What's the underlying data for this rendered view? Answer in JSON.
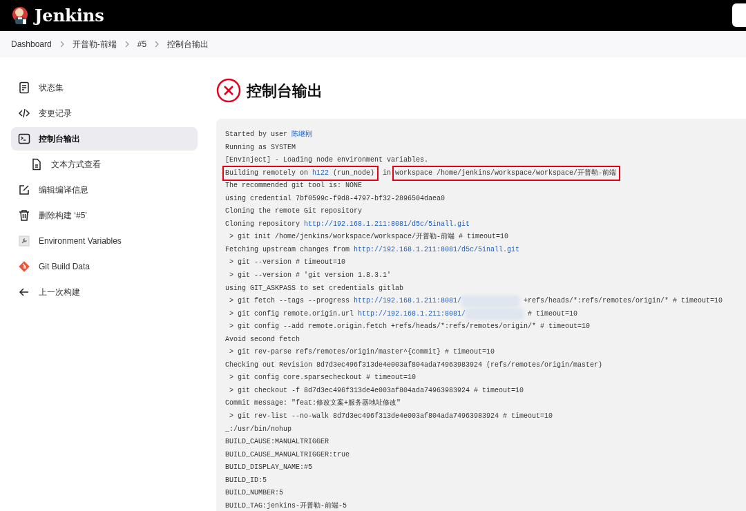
{
  "header": {
    "brand": "Jenkins"
  },
  "breadcrumbs": [
    "Dashboard",
    "开普勒-前端",
    "#5",
    "控制台输出"
  ],
  "sidebar": {
    "items": [
      {
        "kind": "doc",
        "label": "状态集",
        "selected": false
      },
      {
        "kind": "code",
        "label": "变更记录",
        "selected": false
      },
      {
        "kind": "terminal",
        "label": "控制台输出",
        "selected": true
      },
      {
        "kind": "file",
        "label": "文本方式查看",
        "selected": false,
        "sub": true
      },
      {
        "kind": "edit",
        "label": "编辑编译信息",
        "selected": false
      },
      {
        "kind": "trash",
        "label": "删除构建 ‘#5’",
        "selected": false
      },
      {
        "kind": "env",
        "label": "Environment Variables",
        "selected": false
      },
      {
        "kind": "git",
        "label": "Git Build Data",
        "selected": false
      },
      {
        "kind": "back",
        "label": "上一次构建",
        "selected": false
      }
    ]
  },
  "page": {
    "title": "控制台输出",
    "kind": "failed"
  },
  "console": [
    [
      {
        "kind": "text",
        "text": "Started by user "
      },
      {
        "kind": "link",
        "text": "陈继刚"
      }
    ],
    [
      {
        "kind": "text",
        "text": "Running as SYSTEM"
      }
    ],
    [
      {
        "kind": "text",
        "text": "[EnvInject] - Loading node environment variables."
      }
    ],
    [
      {
        "kind": "text",
        "text": "Building remotely on ",
        "boxed": true
      },
      {
        "kind": "link",
        "text": "h122",
        "boxed": true
      },
      {
        "kind": "text",
        "text": " (run_node)",
        "boxed": true
      },
      {
        "kind": "text",
        "text": " in ",
        "boxed": false
      },
      {
        "kind": "text",
        "text": "workspace /home/jenkins/workspace/workspace/开普勒-前端",
        "boxed": true
      }
    ],
    [
      {
        "kind": "text",
        "text": "The recommended git tool is: NONE"
      }
    ],
    [
      {
        "kind": "text",
        "text": "using credential 7bf0599c-f9d8-4797-bf32-2896504daea0"
      }
    ],
    [
      {
        "kind": "text",
        "text": "Cloning the remote Git repository"
      }
    ],
    [
      {
        "kind": "text",
        "text": "Cloning repository "
      },
      {
        "kind": "link",
        "text": "http://192.168.1.211:8081/d5c/5inall.git"
      }
    ],
    [
      {
        "kind": "text",
        "text": " > git init /home/jenkins/workspace/workspace/开普勒-前端 # timeout=10"
      }
    ],
    [
      {
        "kind": "text",
        "text": "Fetching upstream changes from "
      },
      {
        "kind": "link",
        "text": "http://192.168.1.211:8081/d5c/5inall.git"
      }
    ],
    [
      {
        "kind": "text",
        "text": " > git --version # timeout=10"
      }
    ],
    [
      {
        "kind": "text",
        "text": " > git --version # 'git version 1.8.3.1'"
      }
    ],
    [
      {
        "kind": "text",
        "text": "using GIT_ASKPASS to set credentials gitlab"
      }
    ],
    [
      {
        "kind": "text",
        "text": " > git fetch --tags --progress "
      },
      {
        "kind": "link",
        "text": "http://192.168.1.211:8081/"
      },
      {
        "kind": "redacted"
      },
      {
        "kind": "text",
        "text": " +refs/heads/*:refs/remotes/origin/* # timeout=10"
      }
    ],
    [
      {
        "kind": "text",
        "text": " > git config remote.origin.url "
      },
      {
        "kind": "link",
        "text": "http://192.168.1.211:8081/"
      },
      {
        "kind": "redacted"
      },
      {
        "kind": "text",
        "text": " # timeout=10"
      }
    ],
    [
      {
        "kind": "text",
        "text": " > git config --add remote.origin.fetch +refs/heads/*:refs/remotes/origin/* # timeout=10"
      }
    ],
    [
      {
        "kind": "text",
        "text": "Avoid second fetch"
      }
    ],
    [
      {
        "kind": "text",
        "text": " > git rev-parse refs/remotes/origin/master^{commit} # timeout=10"
      }
    ],
    [
      {
        "kind": "text",
        "text": "Checking out Revision 8d7d3ec496f313de4e003af804ada74963983924 (refs/remotes/origin/master)"
      }
    ],
    [
      {
        "kind": "text",
        "text": " > git config core.sparsecheckout # timeout=10"
      }
    ],
    [
      {
        "kind": "text",
        "text": " > git checkout -f 8d7d3ec496f313de4e003af804ada74963983924 # timeout=10"
      }
    ],
    [
      {
        "kind": "text",
        "text": "Commit message: \"feat:修改文案+服务器地址修改\""
      }
    ],
    [
      {
        "kind": "text",
        "text": " > git rev-list --no-walk 8d7d3ec496f313de4e003af804ada74963983924 # timeout=10"
      }
    ],
    [
      {
        "kind": "text",
        "text": "_:/usr/bin/nohup"
      }
    ],
    [
      {
        "kind": "text",
        "text": "BUILD_CAUSE:MANUALTRIGGER"
      }
    ],
    [
      {
        "kind": "text",
        "text": "BUILD_CAUSE_MANUALTRIGGER:true"
      }
    ],
    [
      {
        "kind": "text",
        "text": "BUILD_DISPLAY_NAME:#5"
      }
    ],
    [
      {
        "kind": "text",
        "text": "BUILD_ID:5"
      }
    ],
    [
      {
        "kind": "text",
        "text": "BUILD_NUMBER:5"
      }
    ],
    [
      {
        "kind": "text",
        "text": "BUILD_TAG:jenkins-开普勒-前端-5"
      }
    ]
  ]
}
